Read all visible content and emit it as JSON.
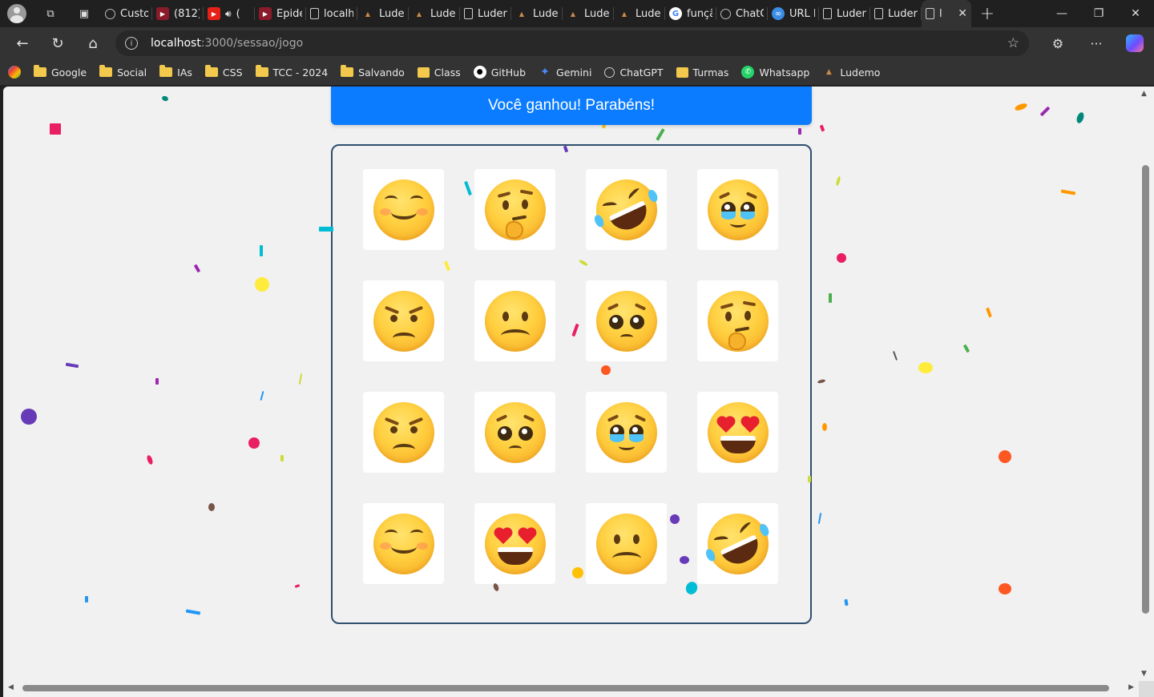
{
  "tabs": [
    {
      "label": "Custo",
      "icon": "chatgpt-icon",
      "color": "#555555"
    },
    {
      "label": "(812)",
      "icon": "youtube-icon",
      "color": "#8b1b2b"
    },
    {
      "label": "(",
      "icon": "youtube-icon",
      "color": "#e62117",
      "audio": true
    },
    {
      "label": "Epide",
      "icon": "youtube-icon",
      "color": "#8b1b2b"
    },
    {
      "label": "localh",
      "icon": "page-icon",
      "color": "#555555"
    },
    {
      "label": "Luder",
      "icon": "ludemo-icon",
      "color": "#555555"
    },
    {
      "label": "Luder",
      "icon": "ludemo-icon",
      "color": "#555555"
    },
    {
      "label": "Luder",
      "icon": "page-icon",
      "color": "#555555"
    },
    {
      "label": "Luder",
      "icon": "ludemo-icon",
      "color": "#555555"
    },
    {
      "label": "Luder",
      "icon": "ludemo-icon",
      "color": "#555555"
    },
    {
      "label": "Luder",
      "icon": "ludemo-icon",
      "color": "#555555"
    },
    {
      "label": "funçã",
      "icon": "google-icon",
      "color": "#ffffff"
    },
    {
      "label": "ChatC",
      "icon": "chatgpt-icon",
      "color": "#555555"
    },
    {
      "label": "URL E",
      "icon": "link-icon",
      "color": "#3a8ee6"
    },
    {
      "label": "Luder",
      "icon": "page-icon",
      "color": "#555555"
    },
    {
      "label": "Luder",
      "icon": "page-icon",
      "color": "#555555"
    },
    {
      "label": "l",
      "icon": "page-icon",
      "color": "#555555",
      "active": true
    }
  ],
  "address": {
    "host": "localhost",
    "path": ":3000/sessao/jogo"
  },
  "bookmarks": [
    {
      "label": "Google",
      "type": "folder"
    },
    {
      "label": "Social",
      "type": "folder"
    },
    {
      "label": "IAs",
      "type": "folder"
    },
    {
      "label": "CSS",
      "type": "folder"
    },
    {
      "label": "TCC - 2024",
      "type": "folder"
    },
    {
      "label": "Salvando",
      "type": "folder"
    },
    {
      "label": "Class",
      "type": "classroom",
      "color": "#f2c94c"
    },
    {
      "label": "GitHub",
      "type": "github",
      "color": "#ffffff"
    },
    {
      "label": "Gemini",
      "type": "gemini",
      "color": "#4a8cff"
    },
    {
      "label": "ChatGPT",
      "type": "chatgpt",
      "color": "#cccccc"
    },
    {
      "label": "Turmas",
      "type": "classroom",
      "color": "#f2c94c"
    },
    {
      "label": "Whatsapp",
      "type": "whatsapp",
      "color": "#25d366"
    },
    {
      "label": "Ludemo",
      "type": "ludemo",
      "color": "#c98a4a"
    }
  ],
  "page": {
    "banner": "Você ganhou! Parabéns!",
    "cards": [
      "smiling-face",
      "thinking-face",
      "rolling-laughing-face",
      "holding-back-tears-face",
      "angry-face",
      "frowning-face",
      "pleading-face",
      "thinking-face",
      "angry-face",
      "pleading-face",
      "holding-back-tears-face",
      "heart-eyes-face",
      "smiling-face",
      "heart-eyes-face",
      "frowning-face",
      "rolling-laughing-face"
    ]
  },
  "colors": {
    "banner": "#0b7cff",
    "board_border": "#2f4f6f",
    "page_bg": "#f1f1f1",
    "browser_chrome": "#202020",
    "toolbar": "#333333"
  }
}
